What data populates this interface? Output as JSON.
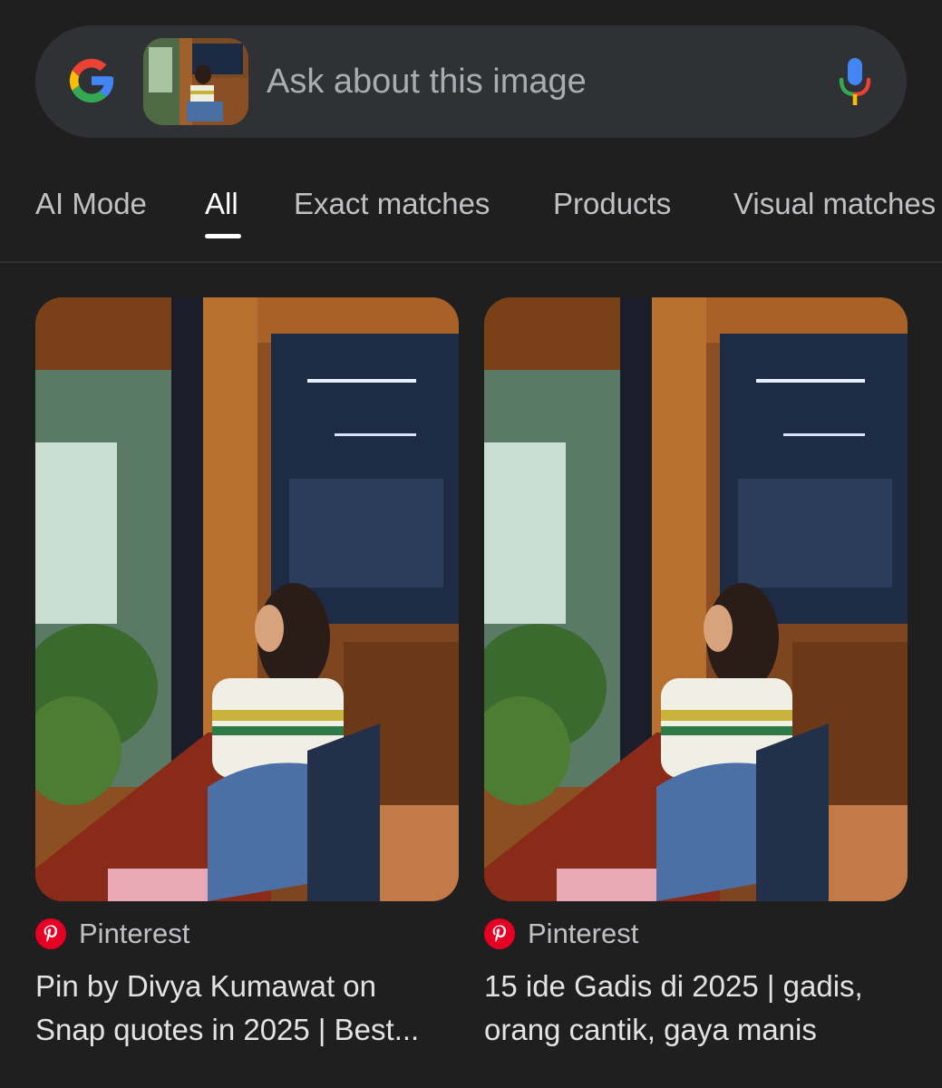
{
  "search": {
    "placeholder": "Ask about this image",
    "logo_icon": "google-g-icon",
    "mic_icon": "microphone-icon"
  },
  "tabs": [
    {
      "label": "AI Mode",
      "active": false
    },
    {
      "label": "All",
      "active": true
    },
    {
      "label": "Exact matches",
      "active": false
    },
    {
      "label": "Products",
      "active": false
    },
    {
      "label": "Visual matches",
      "active": false
    }
  ],
  "results": [
    {
      "source": "Pinterest",
      "source_icon": "pinterest-icon",
      "title_line1": "Pin by Divya Kumawat on",
      "title_line2": "Snap quotes in 2025 | Best..."
    },
    {
      "source": "Pinterest",
      "source_icon": "pinterest-icon",
      "title_line1": "15 ide Gadis di 2025 | gadis,",
      "title_line2": "orang cantik, gaya manis"
    }
  ],
  "colors": {
    "background": "#1f1f1f",
    "search_bg": "#303134",
    "pinterest_red": "#e60023"
  }
}
